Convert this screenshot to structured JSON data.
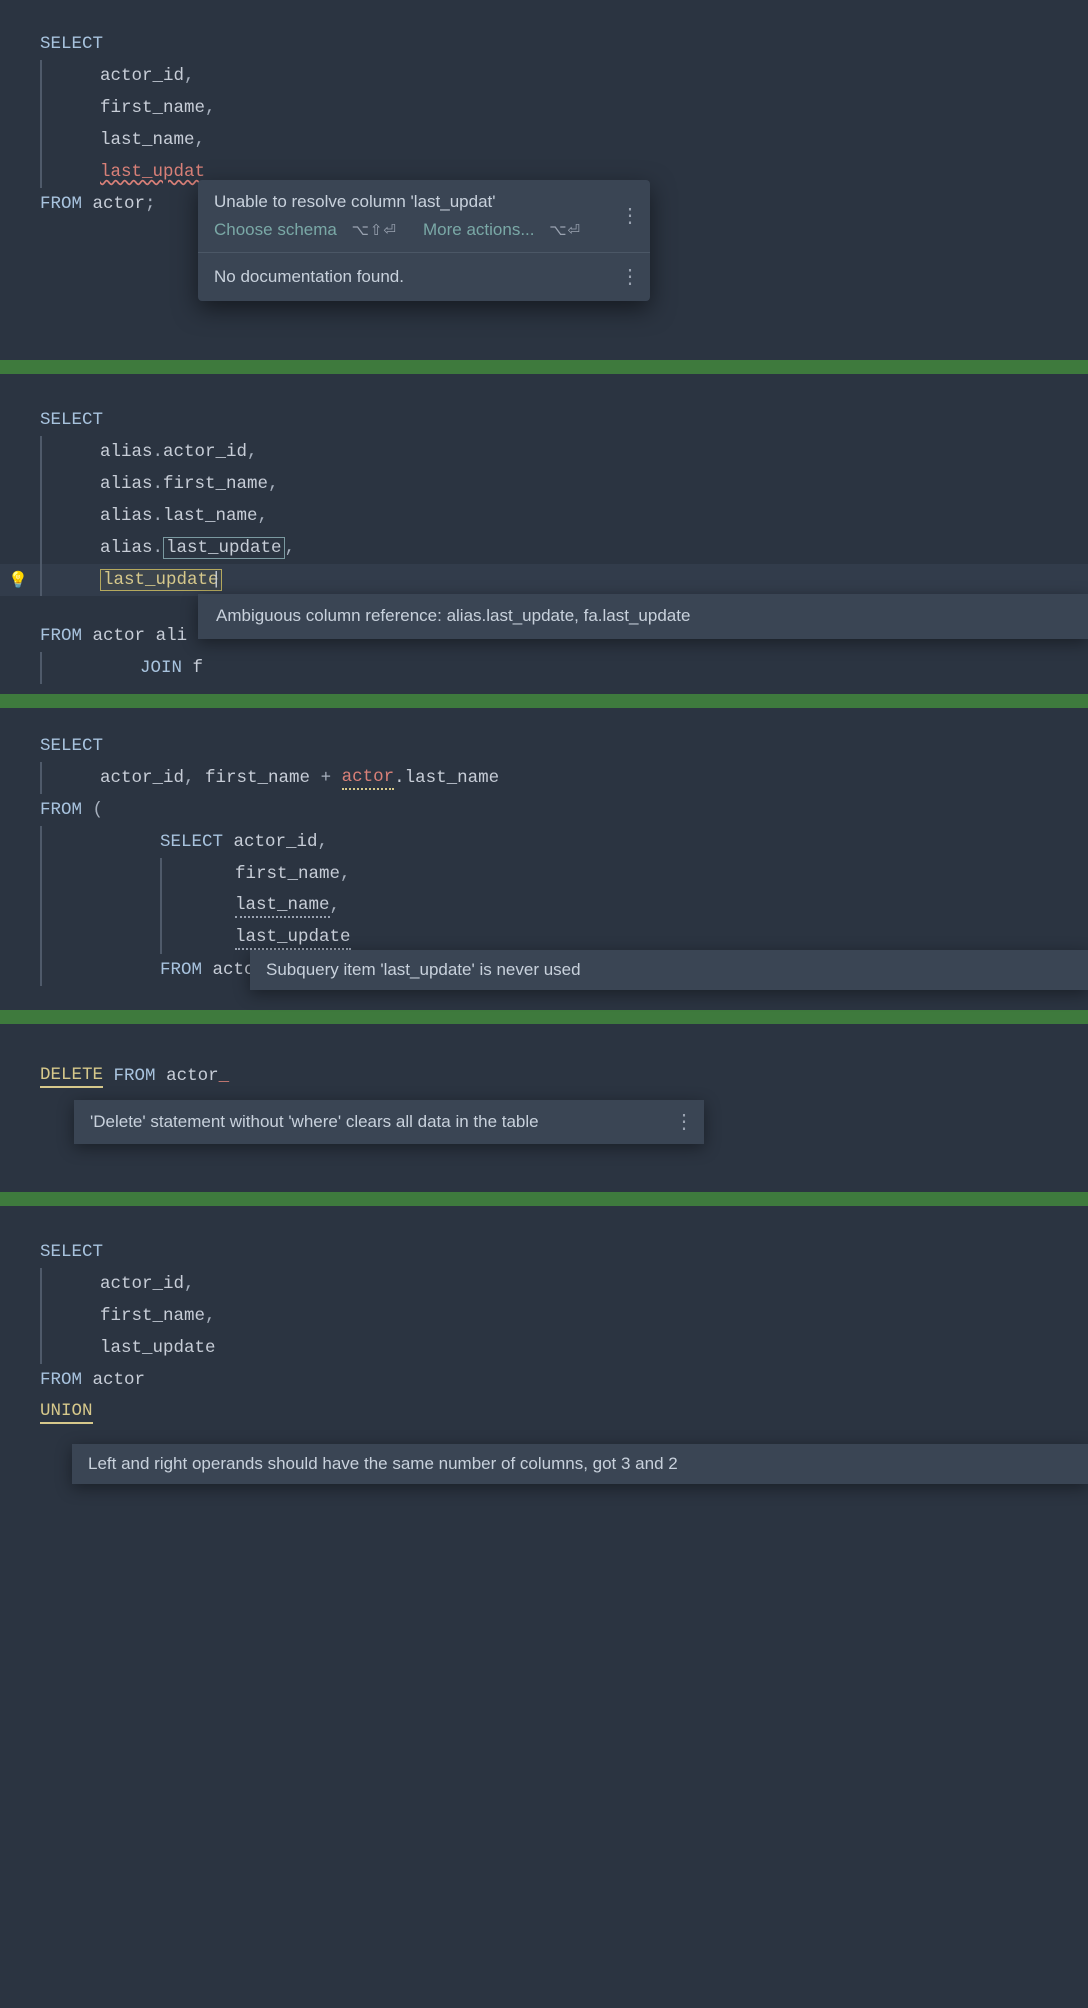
{
  "block1": {
    "kw_select": "SELECT",
    "cols": [
      "actor_id",
      "first_name",
      "last_name"
    ],
    "err_col": "last_updat",
    "kw_from": "FROM",
    "table": "actor",
    "semi": ";",
    "popup": {
      "title": "Unable to resolve column 'last_updat'",
      "choose_schema": "Choose schema",
      "shortcut1": "⌥⇧⏎",
      "more_actions": "More actions...",
      "shortcut2": "⌥⏎",
      "no_doc": "No documentation found."
    }
  },
  "block2": {
    "kw_select": "SELECT",
    "alias": "alias",
    "cols": [
      "actor_id",
      "first_name",
      "last_name",
      "last_update"
    ],
    "ambig_col": "last_update",
    "kw_from": "FROM",
    "table": "actor",
    "alias2": "ali",
    "join_kw": "JOIN",
    "join_partial": "f",
    "tooltip": "Ambiguous column reference: alias.last_update, fa.last_update"
  },
  "block3": {
    "kw_select": "SELECT",
    "col1": "actor_id",
    "col2": "first_name",
    "plus": "+",
    "err_tbl": "actor",
    "dot": ".",
    "err_col": "last_name",
    "kw_from": "FROM",
    "lparen": "(",
    "inner_select": "SELECT",
    "inner_cols": [
      "actor_id",
      "first_name",
      "last_name",
      "last_update"
    ],
    "inner_from": "FROM",
    "inner_table": "actor",
    "tooltip": "Subquery item 'last_update' is never used"
  },
  "block4": {
    "kw_delete": "DELETE",
    "kw_from": "FROM",
    "table": "actor",
    "tooltip": "'Delete' statement without 'where' clears all data in the table"
  },
  "block5": {
    "kw_select": "SELECT",
    "cols": [
      "actor_id",
      "first_name",
      "last_update"
    ],
    "kw_from": "FROM",
    "table": "actor",
    "kw_union": "UNION",
    "tooltip": "Left and right operands should have the same number of columns, got 3 and 2"
  }
}
